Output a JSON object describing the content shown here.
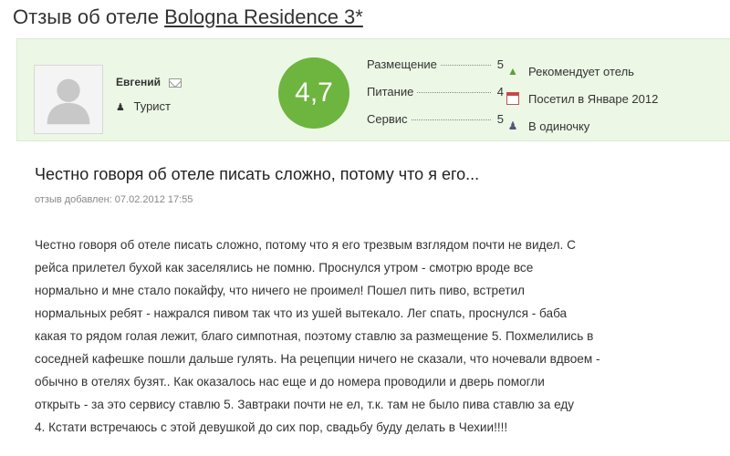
{
  "page": {
    "title_prefix": "Отзыв об отеле",
    "hotel_name": "Bologna Residence 3*"
  },
  "reviewer": {
    "name": "Евгений",
    "role": "Турист"
  },
  "score": "4,7",
  "ratings": [
    {
      "label": "Размещение",
      "value": "5"
    },
    {
      "label": "Питание",
      "value": "4"
    },
    {
      "label": "Сервис",
      "value": "5"
    }
  ],
  "meta": [
    {
      "icon": "thumbs-up-icon",
      "text": "Рекомендует отель"
    },
    {
      "icon": "calendar-icon",
      "text": "Посетил в Январе 2012"
    },
    {
      "icon": "group-icon",
      "text": "В одиночку"
    }
  ],
  "review": {
    "title": "Честно говоря об отеле писать сложно, потому что я его...",
    "date": "отзыв добавлен: 07.02.2012 17:55",
    "lines": [
      "Честно говоря об отеле писать сложно, потому что я его трезвым взглядом почти не видел. С",
      "рейса прилетел бухой как заселялись не помню. Проснулся утром - смотрю вроде все",
      "нормально и мне стало покайфу, что ничего не проимел! Пошел пить пиво, встретил",
      "нормальных ребят - нажрался пивом так что из ушей вытекало. Лег спать, проснулся - баба",
      "какая то рядом голая лежит, благо симпотная, поэтому ставлю за размещение 5. Похмелились в",
      "соседней кафешке пошли дальше гулять. На рецепции ничего не сказали, что ночевали вдвоем -",
      "обычно в отелях бузят.. Как оказалось нас еще и до номера проводили и дверь помогли",
      "открыть - за это сервису ставлю 5. Завтраки почти не ел, т.к. там не было пива ставлю за еду",
      "4. Кстати встречаюсь с этой девушкой до сих пор, свадьбу буду делать в Чехии!!!!"
    ]
  },
  "colors": {
    "card_bg": "#edf7e6",
    "score_bg": "#6db53e"
  }
}
